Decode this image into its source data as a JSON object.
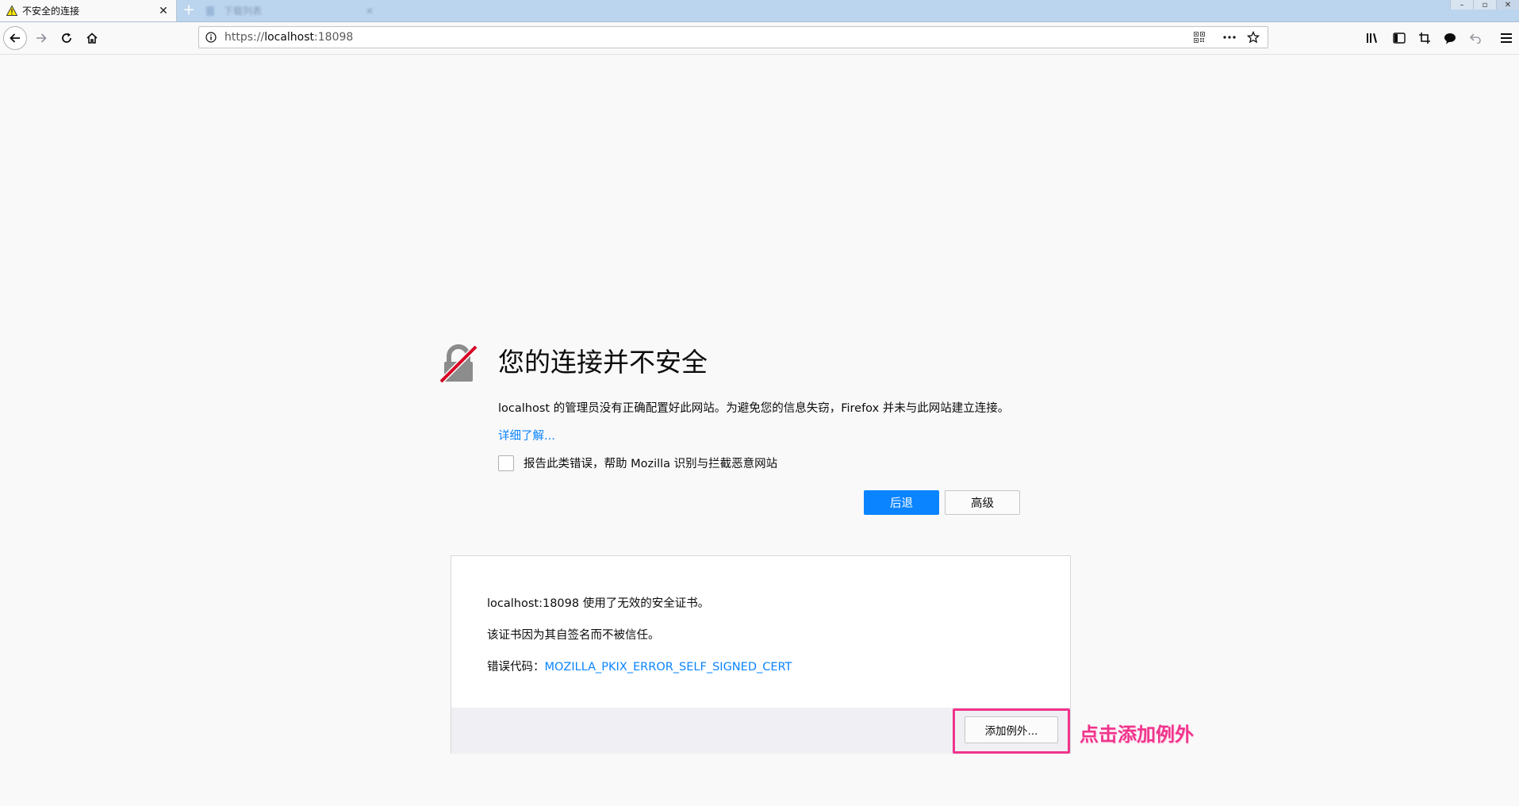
{
  "tabs": {
    "active_title": "不安全的连接",
    "blurred_title": "下载列表",
    "new_tab_glyph": "+"
  },
  "nav": {
    "url_prefix": "https://",
    "url_host": "localhost",
    "url_suffix": ":18098"
  },
  "error": {
    "title": "您的连接并不安全",
    "description": "localhost 的管理员没有正确配置好此网站。为避免您的信息失窃，Firefox 并未与此网站建立连接。",
    "learn_more": "详细了解...",
    "report_label": "报告此类错误，帮助 Mozilla 识别与拦截恶意网站",
    "back_button": "后退",
    "advanced_button": "高级"
  },
  "advanced": {
    "line1": "localhost:18098 使用了无效的安全证书。",
    "line2": "该证书因为其自签名而不被信任。",
    "line3_label": "错误代码：",
    "error_code": "MOZILLA_PKIX_ERROR_SELF_SIGNED_CERT",
    "add_exception_button": "添加例外..."
  },
  "annotation": {
    "text": "点击添加例外"
  },
  "colors": {
    "accent_blue": "#0a84ff",
    "annotation_pink": "#f0348c",
    "lock_slash_red": "#d70022"
  }
}
